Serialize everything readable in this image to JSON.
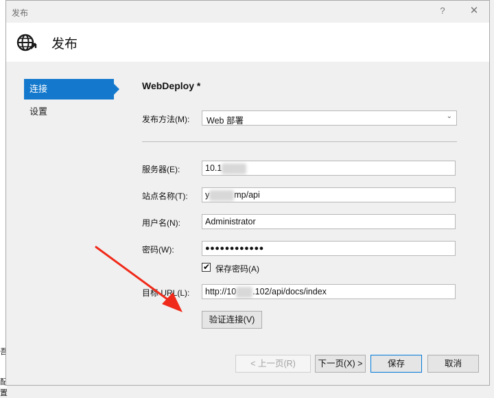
{
  "window": {
    "title": "发布",
    "help_label": "?",
    "close_label": "✕"
  },
  "header": {
    "title": "发布",
    "icon": "globe-publish-icon"
  },
  "backdrop": {
    "fragment_1": "吾",
    "fragment_2": "配置"
  },
  "sidebar": {
    "items": [
      {
        "label": "连接",
        "active": true
      },
      {
        "label": "设置",
        "active": false
      }
    ]
  },
  "section_title": "WebDeploy *",
  "form": {
    "method_label": "发布方法(M):",
    "method_value": "Web 部署",
    "server_label": "服务器(E):",
    "server_value": "10.1",
    "site_label": "站点名称(T):",
    "site_value_prefix": "y",
    "site_value_suffix": "mp/api",
    "username_label": "用户名(N):",
    "username_value": "Administrator",
    "password_label": "密码(W):",
    "password_value": "●●●●●●●●●●●●",
    "save_password_label": "保存密码(A)",
    "save_password_checked": true,
    "target_url_label": "目标 URL(L):",
    "target_url_prefix": "http://10",
    "target_url_suffix": ".102/api/docs/index",
    "validate_button": "验证连接(V)"
  },
  "footer": {
    "prev_button": "< 上一页(R)",
    "next_button": "下一页(X) >",
    "save_button": "保存",
    "cancel_button": "取消"
  },
  "colors": {
    "accent": "#1479cd",
    "arrow": "#f02a1a"
  }
}
